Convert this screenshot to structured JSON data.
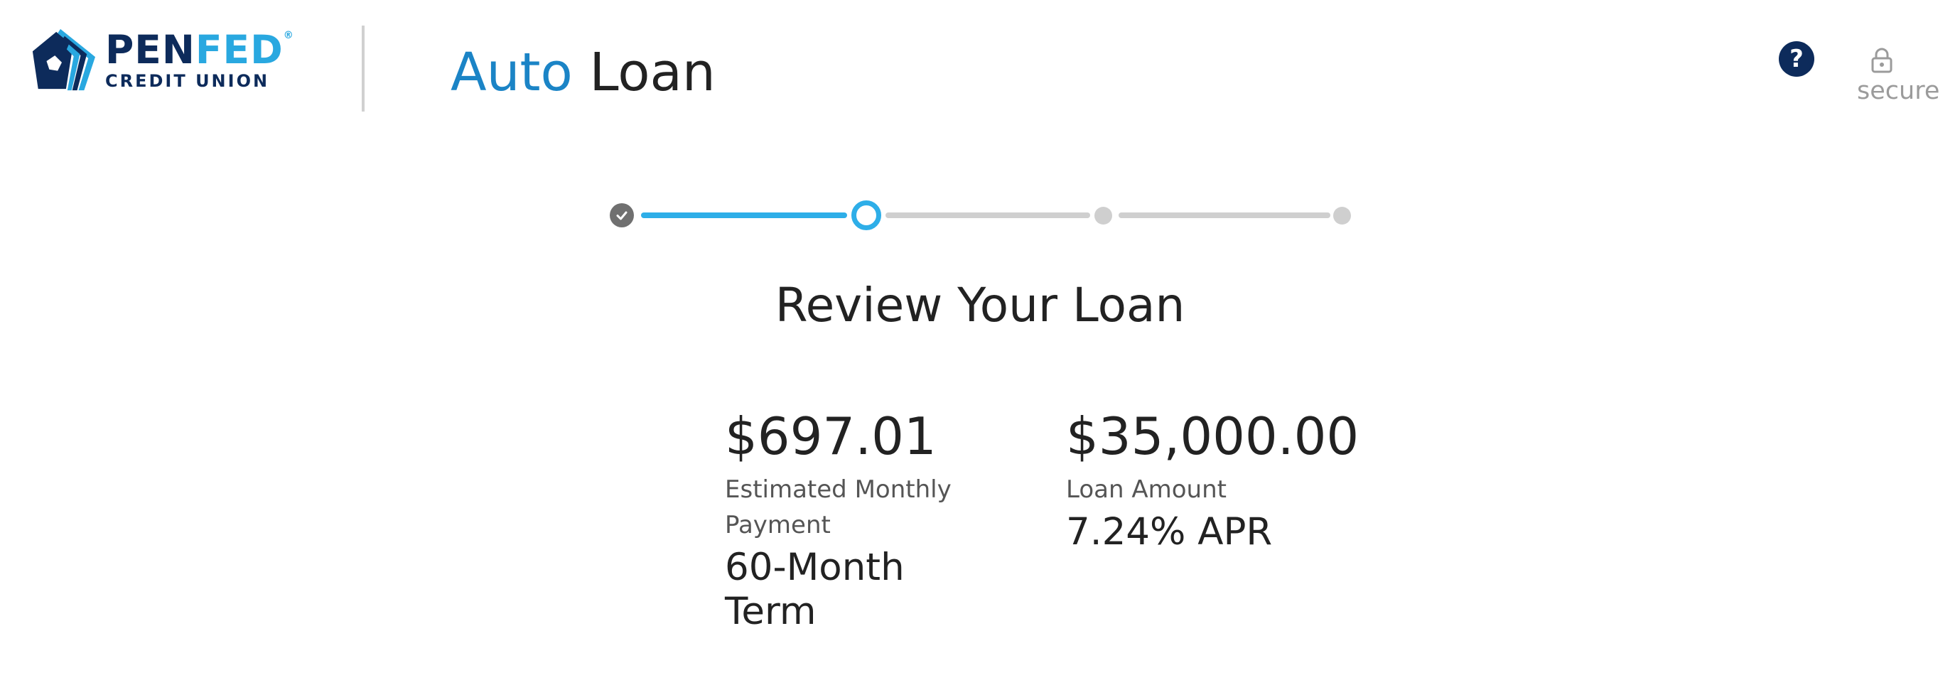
{
  "header": {
    "logo": {
      "word_part_1": "PEN",
      "word_part_2": "FED",
      "subtitle": "CREDIT UNION",
      "registered_mark": "®"
    },
    "product_title_part_1": "Auto",
    "product_title_part_2": "Loan",
    "help_icon": "question-mark-icon",
    "help_glyph": "?",
    "secure_icon": "lock-icon",
    "secure_label": "secure"
  },
  "stepper": {
    "total_steps": 4,
    "current_step": 2,
    "completed_steps": 1,
    "colors": {
      "active": "#2eaee8",
      "completed": "#707070",
      "pending": "#cfcfcf"
    }
  },
  "main": {
    "title": "Review Your Loan",
    "payment": {
      "amount": "$697.01",
      "label": "Estimated Monthly Payment",
      "term": "60-Month Term"
    },
    "loan": {
      "amount": "$35,000.00",
      "label": "Loan Amount",
      "apr": "7.24% APR"
    }
  },
  "colors": {
    "brand_navy": "#0d2b5b",
    "brand_blue": "#29a8e0",
    "product_blue": "#1b84c6"
  }
}
